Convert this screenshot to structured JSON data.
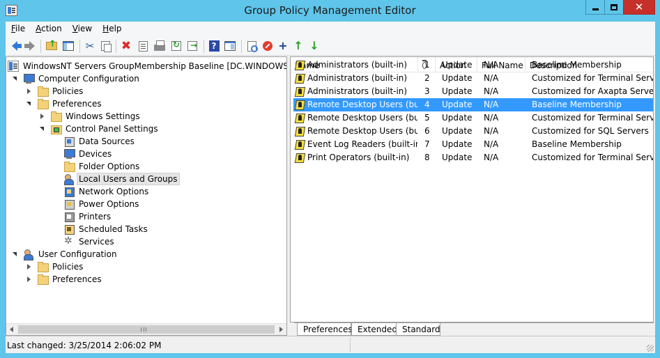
{
  "window": {
    "title": "Group Policy Management Editor"
  },
  "menu": [
    {
      "accel": "F",
      "rest": "ile"
    },
    {
      "accel": "A",
      "rest": "ction"
    },
    {
      "accel": "V",
      "rest": "iew"
    },
    {
      "accel": "H",
      "rest": "elp"
    }
  ],
  "tree": {
    "root": "WindowsNT Servers GroupMembership Baseline [DC.WINDOWSNT.LV]",
    "computer_configuration": "Computer Configuration",
    "policies": "Policies",
    "preferences": "Preferences",
    "windows_settings": "Windows Settings",
    "control_panel_settings": "Control Panel Settings",
    "data_sources": "Data Sources",
    "devices": "Devices",
    "folder_options": "Folder Options",
    "local_users_groups": "Local Users and Groups",
    "network_options": "Network Options",
    "power_options": "Power Options",
    "printers": "Printers",
    "scheduled_tasks": "Scheduled Tasks",
    "services": "Services",
    "user_configuration": "User Configuration",
    "user_policies": "Policies",
    "user_preferences": "Preferences"
  },
  "list": {
    "columns": {
      "name": "Name",
      "action": "Action",
      "full_name": "Full Name",
      "description": "Description"
    },
    "rows": [
      {
        "name": "Administrators (built-in)",
        "order": "1",
        "action": "Update",
        "full_name": "N/A",
        "description": "Baseline Membership"
      },
      {
        "name": "Administrators (built-in)",
        "order": "2",
        "action": "Update",
        "full_name": "N/A",
        "description": "Customized for Terminal Servers"
      },
      {
        "name": "Administrators (built-in)",
        "order": "3",
        "action": "Update",
        "full_name": "N/A",
        "description": "Customized for Axapta Servers"
      },
      {
        "name": "Remote Desktop Users (buil...",
        "order": "4",
        "action": "Update",
        "full_name": "N/A",
        "description": "Baseline Membership"
      },
      {
        "name": "Remote Desktop Users (buil...",
        "order": "5",
        "action": "Update",
        "full_name": "N/A",
        "description": "Customized for Terminal Servers"
      },
      {
        "name": "Remote Desktop Users (buil...",
        "order": "6",
        "action": "Update",
        "full_name": "N/A",
        "description": "Customized for SQL Servers"
      },
      {
        "name": "Event Log Readers (built-in)",
        "order": "7",
        "action": "Update",
        "full_name": "N/A",
        "description": "Baseline Membership"
      },
      {
        "name": "Print Operators (built-in)",
        "order": "8",
        "action": "Update",
        "full_name": "N/A",
        "description": "Customized for Terminal Servers"
      }
    ]
  },
  "tabs": {
    "preferences": "Preferences",
    "extended": "Extended",
    "standard": "Standard"
  },
  "status": {
    "last_changed": "Last changed: 3/25/2014 2:06:02 PM"
  },
  "icons": {
    "help": "?",
    "delete": "✖",
    "scissors": "✂",
    "plus": "+",
    "up": "↑",
    "down": "↓",
    "close": "✕"
  }
}
